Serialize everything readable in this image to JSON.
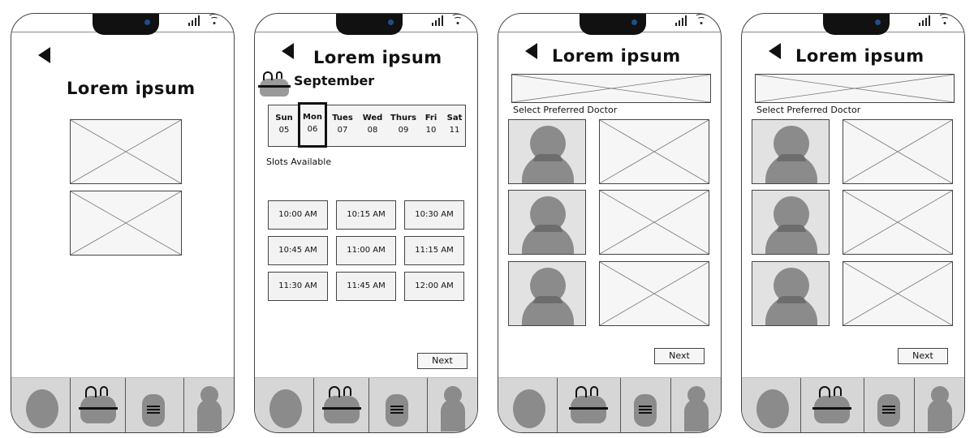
{
  "screens": [
    {
      "title": "Lorem ipsum"
    },
    {
      "title": "Lorem ipsum",
      "month": "September",
      "days": [
        {
          "name": "Sun",
          "date": "05"
        },
        {
          "name": "Mon",
          "date": "06"
        },
        {
          "name": "Tues",
          "date": "07"
        },
        {
          "name": "Wed",
          "date": "08"
        },
        {
          "name": "Thurs",
          "date": "09"
        },
        {
          "name": "Fri",
          "date": "10"
        },
        {
          "name": "Sat",
          "date": "11"
        }
      ],
      "selected_day": "Mon",
      "slots_label": "Slots Available",
      "slots": [
        "10:00 AM",
        "10:15 AM",
        "10:30 AM",
        "10:45 AM",
        "11:00 AM",
        "11:15 AM",
        "11:30 AM",
        "11:45 AM",
        "12:00 AM"
      ],
      "next_label": "Next"
    },
    {
      "title": "Lorem ipsum",
      "select_label": "Select Preferred Doctor",
      "next_label": "Next"
    },
    {
      "title": "Lorem ipsum",
      "select_label": "Select Preferred Doctor",
      "next_label": "Next"
    }
  ],
  "tabbar": {
    "icons": [
      "home-icon",
      "calendar-icon",
      "list-icon",
      "profile-icon"
    ]
  }
}
